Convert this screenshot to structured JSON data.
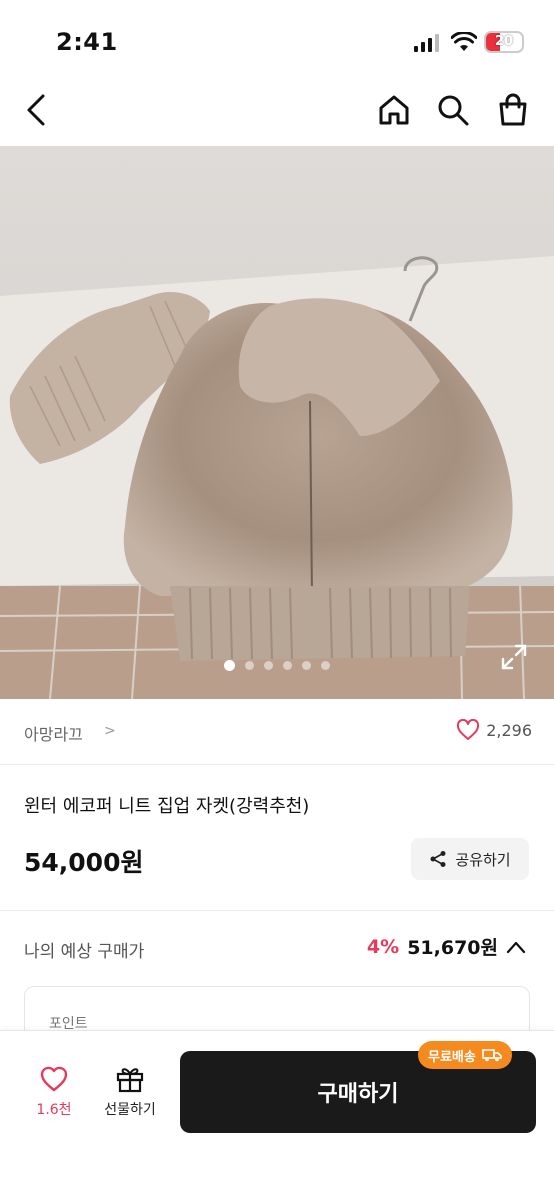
{
  "status_bar": {
    "time": "2:41",
    "battery": "20"
  },
  "nav": {
    "back_icon": "chevron-left-icon",
    "home_icon": "home-icon",
    "search_icon": "search-icon",
    "bag_icon": "shopping-bag-icon"
  },
  "gallery": {
    "slide_count": 6,
    "active_index": 0
  },
  "seller": {
    "name": "아망라끄",
    "chevron": ">",
    "like_count": "2,296"
  },
  "product": {
    "title": "윈터 에코퍼 니트 집업 자켓(강력추천)",
    "price": "54,000원",
    "share_label": "공유하기"
  },
  "expected": {
    "label": "나의 예상 구매가",
    "discount_rate": "4%",
    "price": "51,670원"
  },
  "point": {
    "label": "포인트"
  },
  "bottom_bar": {
    "wish_count": "1.6천",
    "gift_label": "선물하기",
    "buy_label": "구매하기",
    "free_shipping_badge": "무료배송"
  },
  "colors": {
    "accent_pink": "#e8395a",
    "buy_button": "#1a1a1a",
    "badge_orange": "#f58a1f"
  }
}
